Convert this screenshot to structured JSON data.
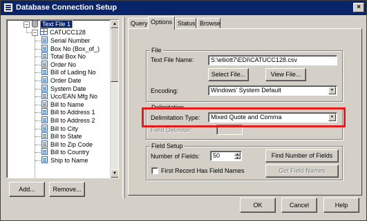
{
  "window": {
    "title": "Database Connection Setup",
    "close_glyph": "×"
  },
  "tree": {
    "root": "Text File 1",
    "table": "CATUCC128",
    "fields": [
      "Serial Number",
      "Box No (Box_of_)",
      "Total Box No",
      "Order No",
      "Bill of Lading No",
      "Order Date",
      "System Date",
      "Ucc/EAN Mfg No",
      "Bill to Name",
      "Bill to Address 1",
      "Bill to Address 2",
      "Bill to City",
      "Bill to State",
      "Bill to Zip Code",
      "Bill to Country",
      "Ship to Name"
    ],
    "expand_glyph": "−"
  },
  "left_buttons": {
    "add": "Add...",
    "remove": "Remove..."
  },
  "tabs": [
    "Query",
    "Options",
    "Status",
    "Browse"
  ],
  "active_tab": "Options",
  "file_group": {
    "title": "File",
    "text_file_name_label": "Text File Name:",
    "text_file_name_value": "S:\\elliott7\\EDI\\CATUCC128.csv",
    "select_file_button": "Select File...",
    "view_file_button": "View File...",
    "encoding_label": "Encoding:",
    "encoding_value": "Windows' System Default"
  },
  "delimitation_group": {
    "title": "Delimitation",
    "type_label": "Delimitation Type:",
    "type_value": "Mixed Quote and Comma",
    "field_delimiter_label": "Field Delimiter:",
    "field_delimiter_value": ""
  },
  "field_setup_group": {
    "title": "Field Setup",
    "number_of_fields_label": "Number of Fields:",
    "number_of_fields_value": "50",
    "find_number_button": "Find Number of Fields",
    "first_record_label": "First Record Has Field Names",
    "first_record_checked": false,
    "get_field_names_button": "Get Field Names"
  },
  "dialog_buttons": {
    "ok": "OK",
    "cancel": "Cancel",
    "help": "Help"
  },
  "colors": {
    "titlebar": "#0a246a",
    "highlight_box": "#e51c1c",
    "face": "#d4d0c8"
  }
}
